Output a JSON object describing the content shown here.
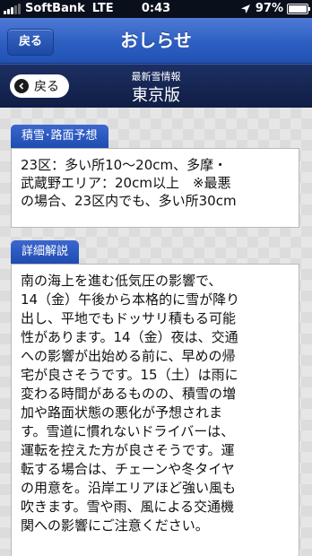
{
  "status_bar": {
    "carrier": "SoftBank",
    "network": "LTE",
    "time": "0:43",
    "battery": "97%"
  },
  "nav": {
    "back_label": "戻る",
    "title": "おしらせ"
  },
  "sub_header": {
    "back_label": "戻る",
    "caption": "最新雪情報",
    "title": "東京版"
  },
  "sections": {
    "forecast": {
      "label": "積雪･路面予想",
      "lines": [
        "23区：多い所10〜20cm、多摩・",
        "武蔵野エリア：20cm以上　※最悪",
        "の場合、23区内でも、多い所30cm"
      ]
    },
    "detail": {
      "label": "詳細解説",
      "lines": [
        "南の海上を進む低気圧の影響で、",
        "14（金）午後から本格的に雪が降り",
        "出し、平地でもドッサリ積もる可能",
        "性があります。14（金）夜は、交通",
        "への影響が出始める前に、早めの帰",
        "宅が良さそうです。15（土）は雨に",
        "変わる時間があるものの、積雪の増",
        "加や路面状態の悪化が予想されま",
        "す。雪道に慣れないドライバーは、",
        "運転を控えた方が良さそうです。運",
        "転する場合は、チェーンや冬タイヤ",
        "の用意を。沿岸エリアほど強い風も",
        "吹きます。雪や雨、風による交通機",
        "関への影響にご注意ください。"
      ]
    }
  }
}
